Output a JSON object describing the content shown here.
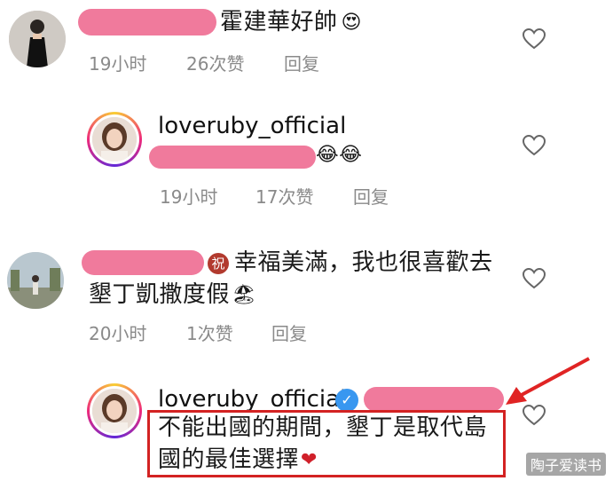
{
  "comments": [
    {
      "text": "霍建華好帥",
      "emoji": "😍",
      "time": "19小时",
      "likes": "26次赞",
      "reply": "回复"
    },
    {
      "username": "loveruby_official",
      "emoji": "😂😂",
      "time": "19小时",
      "likes": "17次赞",
      "reply": "回复"
    },
    {
      "badge": "祝",
      "text_line1": "幸福美滿，我也很喜歡去",
      "text_line2": "墾丁凱撒度假",
      "emoji": "🏖",
      "time": "20小时",
      "likes": "1次赞",
      "reply": "回复"
    },
    {
      "username": "loveruby_official",
      "verified": "✓",
      "text_line1": "不能出國的期間，墾丁是取代島",
      "text_line2": "國的最佳選擇",
      "emoji": "❤"
    }
  ],
  "watermark": "陶子爱读书",
  "colors": {
    "redaction": "#f07a9c",
    "highlight": "#d32222",
    "meta": "#8a8a8a"
  }
}
